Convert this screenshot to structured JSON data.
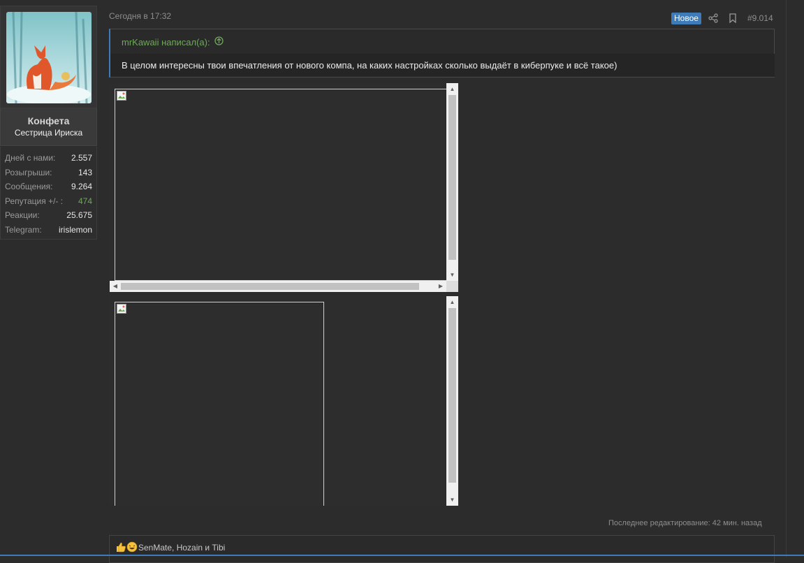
{
  "user": {
    "name": "Конфета",
    "title": "Сестрица Ириска",
    "stats": [
      {
        "label": "Дней с нами:",
        "value": "2.557"
      },
      {
        "label": "Розыгрыши:",
        "value": "143"
      },
      {
        "label": "Сообщения:",
        "value": "9.264"
      },
      {
        "label": "Репутация +/- :",
        "value": "474"
      },
      {
        "label": "Реакции:",
        "value": "25.675"
      },
      {
        "label": "Telegram:",
        "value": "irislemon"
      }
    ]
  },
  "post": {
    "date": "Сегодня в 17:32",
    "badge": "Новое",
    "number": "#9.014",
    "quote": {
      "author": "mrKawaii написал(а):",
      "text": "В целом интересны твои впечатления от нового компа, на каких настройках сколько выдаёт в киберпуке и всё такое)"
    },
    "last_edit": "Последнее редактирование: 42 мин. назад",
    "reactions_text": "SenMate, Hozain и Tibi"
  },
  "colors": {
    "accent": "#3d7cb8",
    "green": "#6fa85a",
    "background": "#2c2c2c"
  },
  "icons": [
    "share-icon",
    "bookmark-icon",
    "arrow-up-circle-icon",
    "broken-image-icon",
    "thumbs-up-icon",
    "laugh-icon"
  ]
}
